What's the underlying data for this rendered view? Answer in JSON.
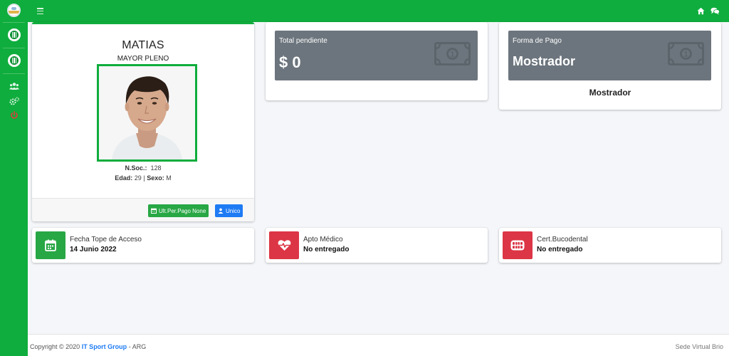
{
  "topbar": {
    "menu_icon": "bars-icon",
    "home_icon": "home-icon",
    "chat_icon": "comments-icon"
  },
  "sidebar": {
    "icons": [
      "club-logo-icon",
      "club-crest-icon",
      "club-crest-icon",
      "users-icon",
      "cogs-icon",
      "power-icon"
    ]
  },
  "profile": {
    "name": "MATIAS",
    "category": "MAYOR PLENO",
    "member_number_label": "N.Soc.:",
    "member_number": "128",
    "age_label": "Edad:",
    "age": "29",
    "separator": "|",
    "sex_label": "Sexo:",
    "sex": "M",
    "last_payment_button": "Ult.Per.Pago None",
    "unique_button": "Unico"
  },
  "pending": {
    "label": "Total pendiente",
    "value": "$ 0"
  },
  "payment": {
    "label": "Forma de Pago",
    "value": "Mostrador",
    "text": "Mostrador"
  },
  "status": {
    "access": {
      "label": "Fecha Tope de Acceso",
      "value": "14 Junio 2022"
    },
    "medical": {
      "label": "Apto Médico",
      "value": "No entregado"
    },
    "dental": {
      "label": "Cert.Bucodental",
      "value": "No entregado"
    }
  },
  "footer": {
    "copyright": "Copyright © 2020",
    "brand": "IT Sport Group",
    "suffix": "- ARG",
    "right": "Sede Virtual Brio"
  },
  "colors": {
    "primary_green": "#0fad3d",
    "button_green": "#28a745",
    "button_blue": "#1e7bf4",
    "danger": "#dc3545",
    "box_gray": "#6c757d"
  }
}
